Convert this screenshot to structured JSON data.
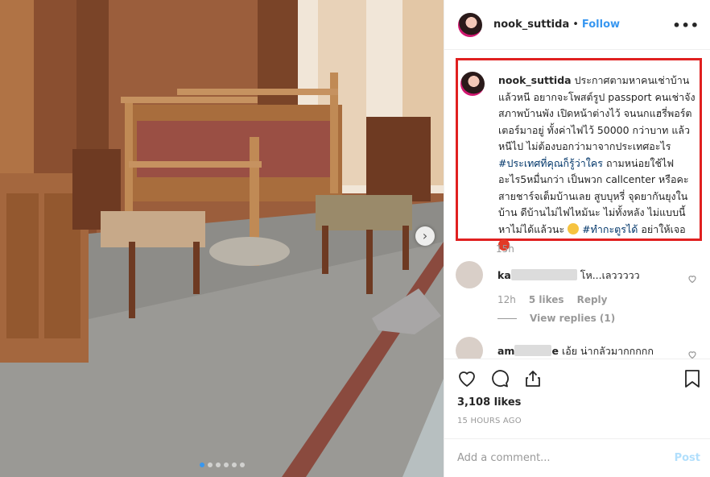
{
  "post": {
    "username": "nook_suttida",
    "separator": "•",
    "follow_label": "Follow",
    "more_icon": "more-options-icon",
    "caption_username": "nook_suttida",
    "caption_part1": "ประกาศตามหาคนเช่าบ้าน แล้วหนี อยากจะโพสต์รูป passport คนเช่าจัง สภาพบ้านพัง เปิดหน้าต่างไว้ จนนกแฮรี่พอร์ตเตอร์มาอยู่ ทั้งค่าไฟไว้ 50000 กว่าบาท แล้วหนีไป ไม่ต้องบอกว่ามาจากประเทศอะไร ",
    "caption_hashtag1": "#ประเทศที่คุณก็รู้ว่าใคร",
    "caption_part2": " ถามหน่อยใช้ไฟอะไร5หมื่นกว่า เป็นพวก callcenter หรือคะ สายชาร์จเต็มบ้านเลย สูบบุหรี่ จุดยากันยุงในบ้าน ดีบ้านไม่ไฟไหม้นะ ไม่ทั้งหลัง ไม่แบบนี้หาไม่ได้แล้วนะ ",
    "caption_hashtag2": "#ทำกะตูรได้",
    "caption_part3": " อย่าให้เจอ",
    "caption_time": "15h",
    "likes": "3,108 likes",
    "timestamp": "15 HOURS AGO",
    "photo_next_icon": "chevron-right-icon",
    "photo_dots_count": 6,
    "photo_active_dot": 0
  },
  "comments": [
    {
      "user_visible": "ka",
      "text": "โห...เลววววว",
      "time": "12h",
      "likes": "5 likes",
      "reply": "Reply",
      "view_replies": "View replies (1)"
    },
    {
      "user_visible_start": "am",
      "user_visible_end": "e",
      "text": "เอ้ย น่ากลัวมากกกกก"
    }
  ],
  "comment_box": {
    "placeholder": "Add a comment...",
    "post_label": "Post"
  },
  "colors": {
    "link_blue": "#3897f0",
    "highlight_red": "#e02020",
    "hashtag": "#003569"
  }
}
